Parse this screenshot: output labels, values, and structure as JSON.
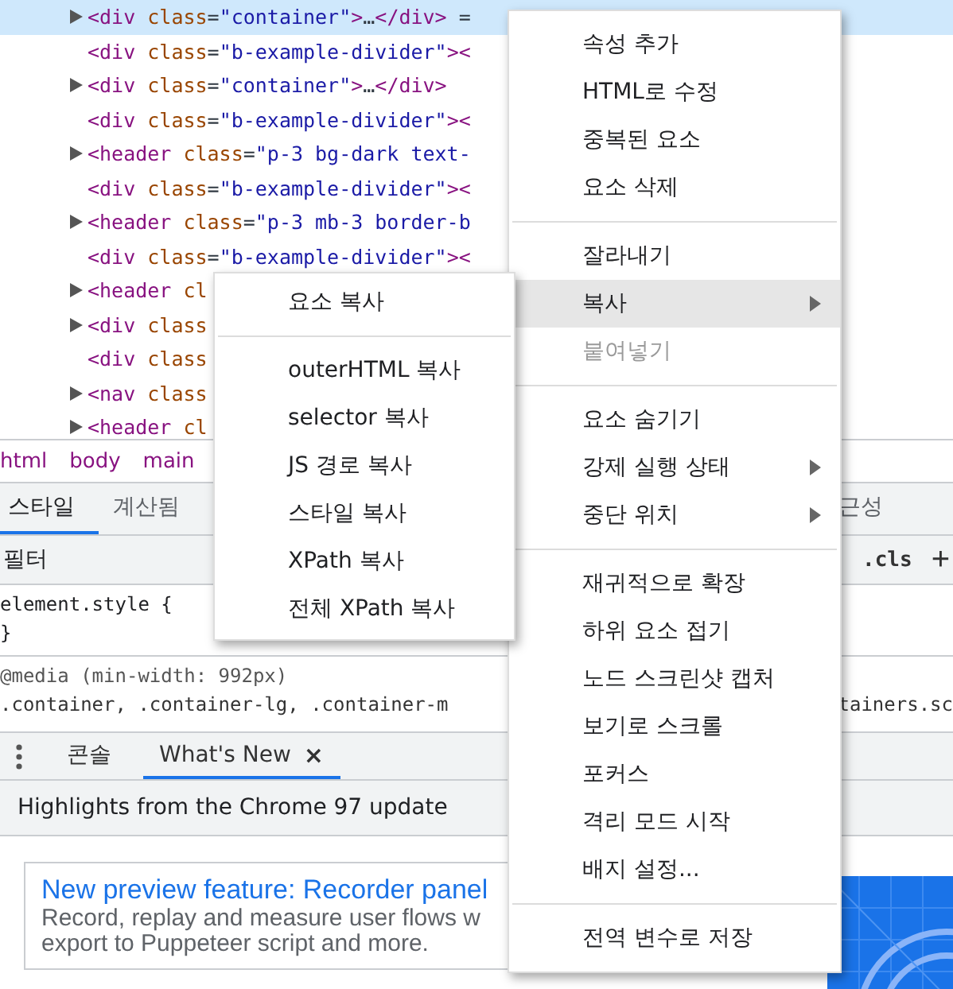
{
  "dom_tree": [
    {
      "expandable": true,
      "selected": true,
      "segments": [
        {
          "kind": "tag",
          "text": "<div "
        },
        {
          "kind": "attr",
          "text": "class"
        },
        {
          "kind": "plain",
          "text": "="
        },
        {
          "kind": "value",
          "text": "\"container\""
        },
        {
          "kind": "tag",
          "text": ">"
        },
        {
          "kind": "plain",
          "text": "…"
        },
        {
          "kind": "tag",
          "text": "</div>"
        },
        {
          "kind": "plain",
          "text": " ="
        }
      ]
    },
    {
      "expandable": false,
      "selected": false,
      "segments": [
        {
          "kind": "tag",
          "text": "<div "
        },
        {
          "kind": "attr",
          "text": "class"
        },
        {
          "kind": "plain",
          "text": "="
        },
        {
          "kind": "value",
          "text": "\"b-example-divider\""
        },
        {
          "kind": "tag",
          "text": "><"
        }
      ]
    },
    {
      "expandable": true,
      "selected": false,
      "segments": [
        {
          "kind": "tag",
          "text": "<div "
        },
        {
          "kind": "attr",
          "text": "class"
        },
        {
          "kind": "plain",
          "text": "="
        },
        {
          "kind": "value",
          "text": "\"container\""
        },
        {
          "kind": "tag",
          "text": ">"
        },
        {
          "kind": "plain",
          "text": "…"
        },
        {
          "kind": "tag",
          "text": "</div>"
        }
      ]
    },
    {
      "expandable": false,
      "selected": false,
      "segments": [
        {
          "kind": "tag",
          "text": "<div "
        },
        {
          "kind": "attr",
          "text": "class"
        },
        {
          "kind": "plain",
          "text": "="
        },
        {
          "kind": "value",
          "text": "\"b-example-divider\""
        },
        {
          "kind": "tag",
          "text": "><"
        }
      ]
    },
    {
      "expandable": true,
      "selected": false,
      "segments": [
        {
          "kind": "tag",
          "text": "<header "
        },
        {
          "kind": "attr",
          "text": "class"
        },
        {
          "kind": "plain",
          "text": "="
        },
        {
          "kind": "value",
          "text": "\"p-3 bg-dark text-"
        }
      ]
    },
    {
      "expandable": false,
      "selected": false,
      "segments": [
        {
          "kind": "tag",
          "text": "<div "
        },
        {
          "kind": "attr",
          "text": "class"
        },
        {
          "kind": "plain",
          "text": "="
        },
        {
          "kind": "value",
          "text": "\"b-example-divider\""
        },
        {
          "kind": "tag",
          "text": "><"
        }
      ]
    },
    {
      "expandable": true,
      "selected": false,
      "segments": [
        {
          "kind": "tag",
          "text": "<header "
        },
        {
          "kind": "attr",
          "text": "class"
        },
        {
          "kind": "plain",
          "text": "="
        },
        {
          "kind": "value",
          "text": "\"p-3 mb-3 border-b"
        }
      ]
    },
    {
      "expandable": false,
      "selected": false,
      "segments": [
        {
          "kind": "tag",
          "text": "<div "
        },
        {
          "kind": "attr",
          "text": "class"
        },
        {
          "kind": "plain",
          "text": "="
        },
        {
          "kind": "value",
          "text": "\"b-example-divider\""
        },
        {
          "kind": "tag",
          "text": "><"
        }
      ]
    },
    {
      "expandable": true,
      "selected": false,
      "segments": [
        {
          "kind": "tag",
          "text": "<header "
        },
        {
          "kind": "attr",
          "text": "cl"
        }
      ]
    },
    {
      "expandable": true,
      "selected": false,
      "segments": [
        {
          "kind": "tag",
          "text": "<div "
        },
        {
          "kind": "attr",
          "text": "class"
        }
      ]
    },
    {
      "expandable": false,
      "selected": false,
      "segments": [
        {
          "kind": "tag",
          "text": "<div "
        },
        {
          "kind": "attr",
          "text": "class"
        }
      ]
    },
    {
      "expandable": true,
      "selected": false,
      "segments": [
        {
          "kind": "tag",
          "text": "<nav "
        },
        {
          "kind": "attr",
          "text": "class"
        }
      ]
    },
    {
      "expandable": true,
      "selected": false,
      "segments": [
        {
          "kind": "tag",
          "text": "<header "
        },
        {
          "kind": "attr",
          "text": "cl"
        }
      ]
    }
  ],
  "breadcrumbs": [
    "html",
    "body",
    "main"
  ],
  "styles_tabs": [
    {
      "label": "스타일",
      "selected": true
    },
    {
      "label": "계산됨",
      "selected": false
    }
  ],
  "styles_tab_cut": "근성",
  "filter": {
    "placeholder": "필터"
  },
  "cls_button": ".cls",
  "add_button": "+",
  "style_lines": [
    {
      "kind": "rule",
      "text": "element.style {"
    },
    {
      "kind": "rule",
      "text": "}"
    },
    {
      "kind": "divider"
    },
    {
      "kind": "media",
      "text": "@media (min-width: 992px)"
    },
    {
      "kind": "selector",
      "text": ".container, .container-lg, .container-m",
      "tail": "tainers.sc"
    }
  ],
  "drawer": {
    "tabs": [
      {
        "label": "콘솔",
        "selected": false,
        "closable": false
      },
      {
        "label": "What's New",
        "selected": true,
        "closable": true
      }
    ],
    "close_glyph": "×",
    "header": "Highlights from the Chrome 97 update",
    "card": {
      "title": "New preview feature: Recorder panel",
      "lines": [
        "Record, replay and measure user flows w",
        "export to Puppeteer script and more."
      ]
    }
  },
  "context_menu": [
    [
      {
        "label": "속성 추가",
        "selected": false,
        "disabled": false,
        "submenu": false
      },
      {
        "label": "HTML로 수정",
        "selected": false,
        "disabled": false,
        "submenu": false
      },
      {
        "label": "중복된 요소",
        "selected": false,
        "disabled": false,
        "submenu": false
      },
      {
        "label": "요소 삭제",
        "selected": false,
        "disabled": false,
        "submenu": false
      }
    ],
    [
      {
        "label": "잘라내기",
        "selected": false,
        "disabled": false,
        "submenu": false
      },
      {
        "label": "복사",
        "selected": true,
        "disabled": false,
        "submenu": true
      },
      {
        "label": "붙여넣기",
        "selected": false,
        "disabled": true,
        "submenu": false
      }
    ],
    [
      {
        "label": "요소 숨기기",
        "selected": false,
        "disabled": false,
        "submenu": false
      },
      {
        "label": "강제 실행 상태",
        "selected": false,
        "disabled": false,
        "submenu": true
      },
      {
        "label": "중단 위치",
        "selected": false,
        "disabled": false,
        "submenu": true
      }
    ],
    [
      {
        "label": "재귀적으로 확장",
        "selected": false,
        "disabled": false,
        "submenu": false
      },
      {
        "label": "하위 요소 접기",
        "selected": false,
        "disabled": false,
        "submenu": false
      },
      {
        "label": "노드 스크린샷 캡처",
        "selected": false,
        "disabled": false,
        "submenu": false
      },
      {
        "label": "보기로 스크롤",
        "selected": false,
        "disabled": false,
        "submenu": false
      },
      {
        "label": "포커스",
        "selected": false,
        "disabled": false,
        "submenu": false
      },
      {
        "label": "격리 모드 시작",
        "selected": false,
        "disabled": false,
        "submenu": false
      },
      {
        "label": "배지 설정...",
        "selected": false,
        "disabled": false,
        "submenu": false
      }
    ],
    [
      {
        "label": "전역 변수로 저장",
        "selected": false,
        "disabled": false,
        "submenu": false
      }
    ]
  ],
  "copy_submenu": [
    [
      {
        "label": "요소 복사"
      }
    ],
    [
      {
        "label": "outerHTML 복사"
      },
      {
        "label": "selector 복사"
      },
      {
        "label": "JS 경로 복사"
      },
      {
        "label": "스타일 복사"
      },
      {
        "label": "XPath 복사"
      },
      {
        "label": "전체 XPath 복사"
      }
    ]
  ]
}
